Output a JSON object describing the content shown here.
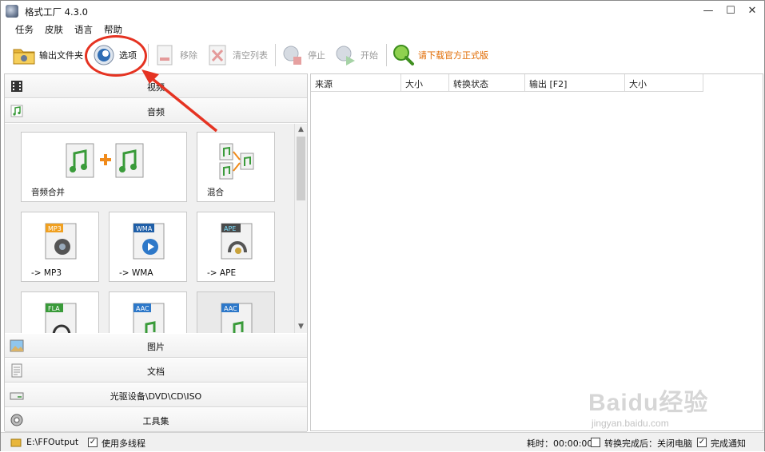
{
  "window": {
    "title": "格式工厂 4.3.0"
  },
  "menu": [
    "任务",
    "皮肤",
    "语言",
    "帮助"
  ],
  "toolbar": {
    "output_folder": "输出文件夹",
    "options": "选项",
    "remove": "移除",
    "clear_list": "清空列表",
    "stop": "停止",
    "start": "开始",
    "download": "请下载官方正式版"
  },
  "categories": {
    "video": "视频",
    "audio": "音频",
    "image": "图片",
    "document": "文档",
    "disc": "光驱设备\\DVD\\CD\\ISO",
    "tools": "工具集"
  },
  "tiles": {
    "merge": "音频合并",
    "mix": "混合",
    "mp3": "-> MP3",
    "wma": "-> WMA",
    "ape": "-> APE",
    "badge_mp3": "MP3",
    "badge_wma": "WMA",
    "badge_ape": "APE",
    "badge_fla": "FLA",
    "badge_aac1": "AAC",
    "badge_aac2": "AAC"
  },
  "table": {
    "columns": [
      "来源",
      "大小",
      "转换状态",
      "输出 [F2]",
      "大小"
    ]
  },
  "status": {
    "output_path": "E:\\FFOutput",
    "multithread": "使用多线程",
    "elapsed": "耗时：00:00:00",
    "after_convert": "转换完成后：关闭电脑",
    "notify": "完成通知"
  },
  "watermark": {
    "brand": "Baidu经验",
    "url": "jingyan.baidu.com"
  },
  "colors": {
    "accent_red": "#e53322",
    "download_orange": "#e06a00"
  }
}
